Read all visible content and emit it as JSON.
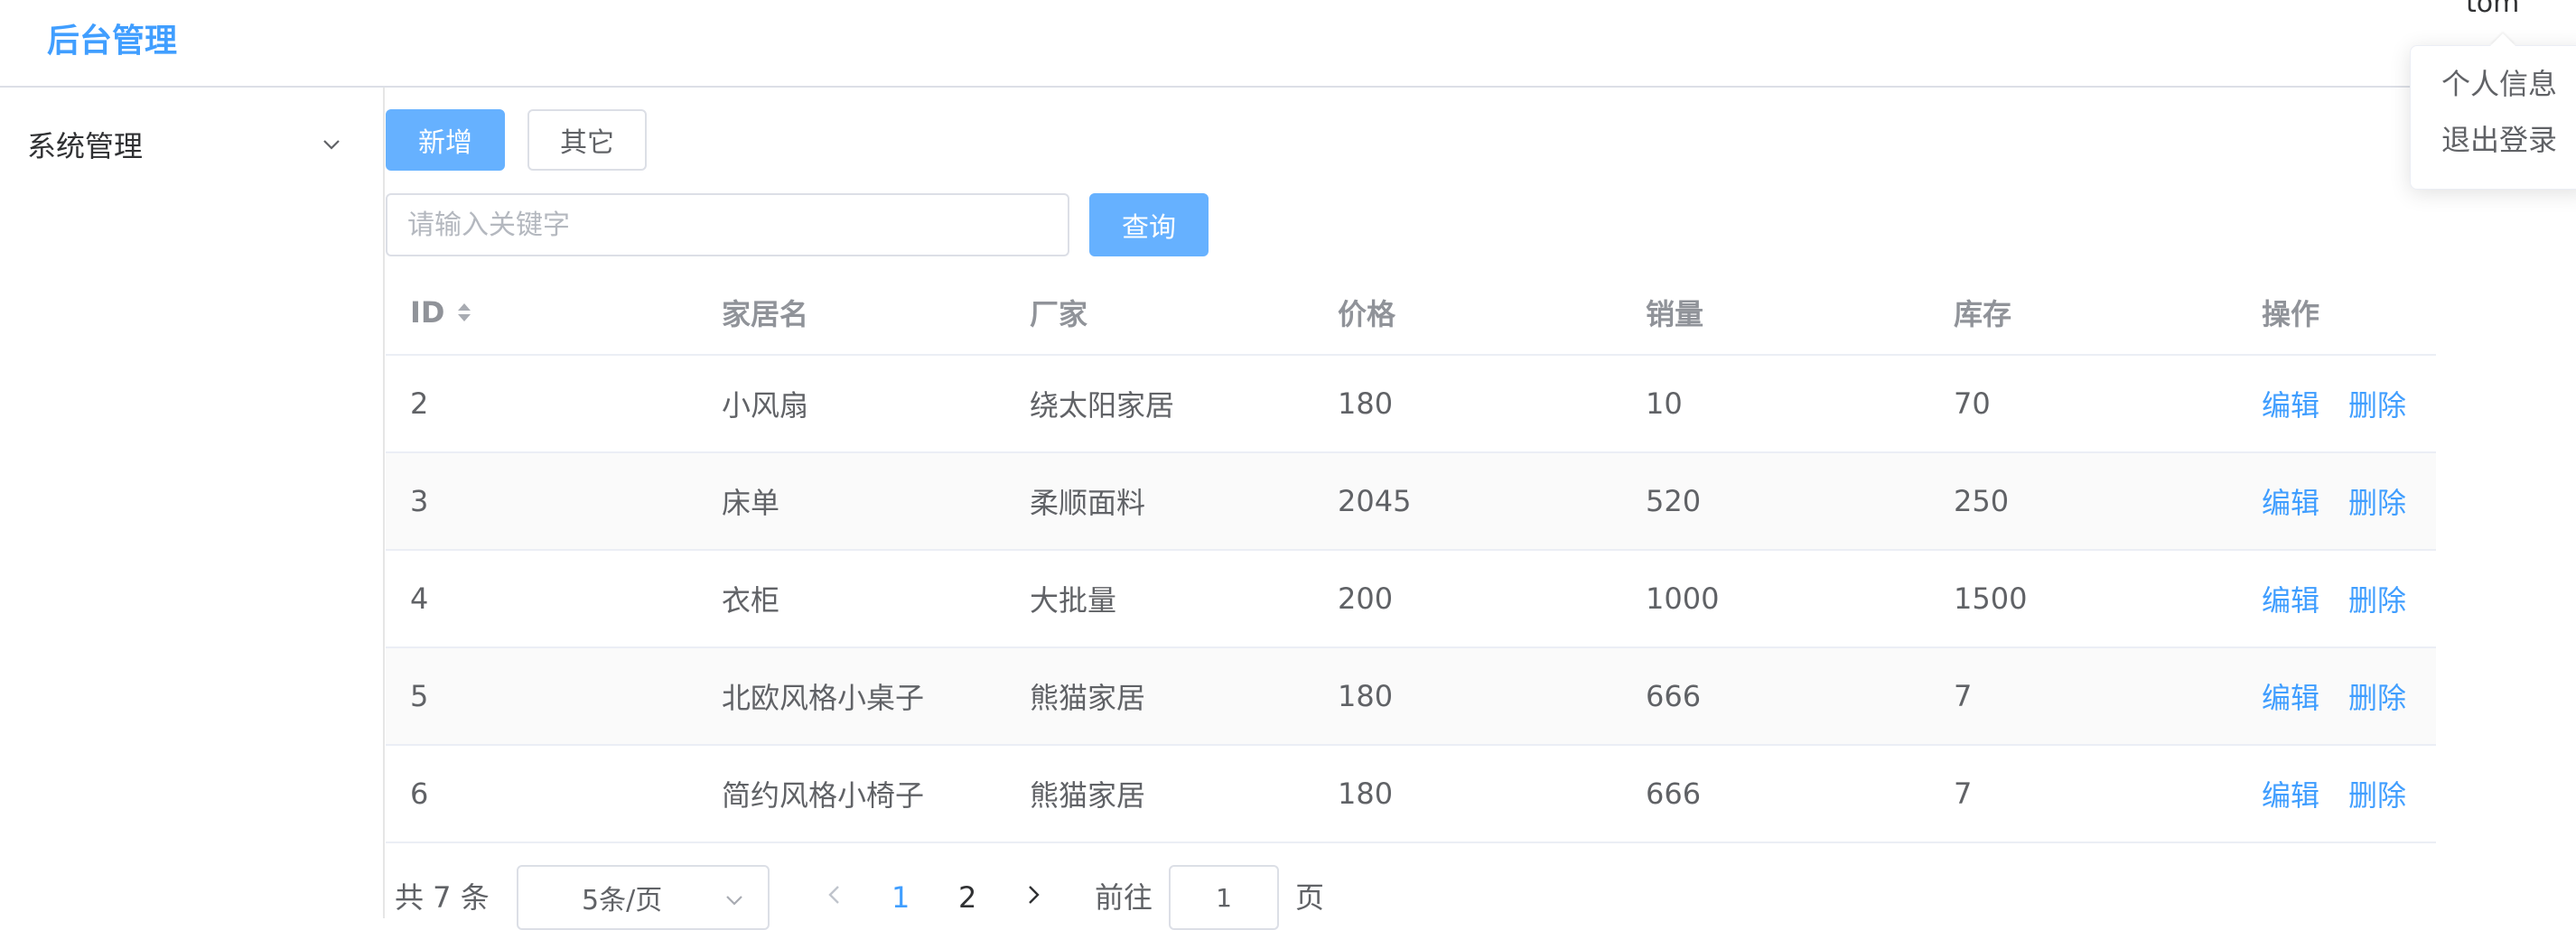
{
  "header": {
    "brand": "后台管理",
    "user": "tom",
    "dropdown": [
      "个人信息",
      "退出登录"
    ]
  },
  "sidebar": {
    "items": [
      {
        "label": "系统管理",
        "icon": "chevron-down-icon"
      }
    ]
  },
  "toolbar": {
    "add_label": "新增",
    "other_label": "其它",
    "search_placeholder": "请输入关键字",
    "search_value": "",
    "query_label": "查询"
  },
  "table": {
    "columns": [
      "ID",
      "家居名",
      "厂家",
      "价格",
      "销量",
      "库存",
      "操作"
    ],
    "rows": [
      [
        "2",
        "小风扇",
        "绕太阳家居",
        "180",
        "10",
        "70"
      ],
      [
        "3",
        "床单",
        "柔顺面料",
        "2045",
        "520",
        "250"
      ],
      [
        "4",
        "衣柜",
        "大批量",
        "200",
        "1000",
        "1500"
      ],
      [
        "5",
        "北欧风格小桌子",
        "熊猫家居",
        "180",
        "666",
        "7"
      ],
      [
        "6",
        "简约风格小椅子",
        "熊猫家居",
        "180",
        "666",
        "7"
      ]
    ],
    "actions": {
      "edit": "编辑",
      "delete": "删除"
    }
  },
  "pagination": {
    "total": "共 7 条",
    "page_size": "5条/页",
    "pages": [
      "1",
      "2"
    ],
    "current_page": "1",
    "goto_label": "前往",
    "goto_value": "1",
    "page_suffix": "页"
  },
  "colors": {
    "primary": "#409eff",
    "primary_light": "#66b1ff",
    "border": "#dcdfe6"
  }
}
